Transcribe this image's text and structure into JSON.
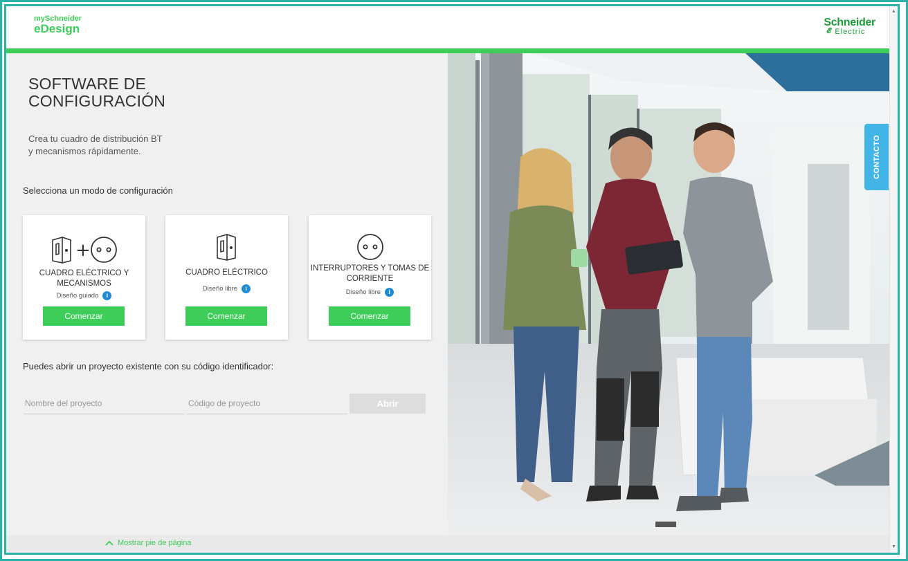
{
  "header": {
    "logo_line1": "mySchneider",
    "logo_line2": "eDesign",
    "brand_line1": "Schneider",
    "brand_line2": "Electric"
  },
  "hero": {
    "title_line1": "SOFTWARE DE",
    "title_line2": "CONFIGURACIÓN",
    "subtitle_line1": "Crea tu cuadro de distribución BT",
    "subtitle_line2": "y mecanismos rápidamente."
  },
  "modes": {
    "label": "Selecciona un modo de configuración",
    "cards": [
      {
        "title_line1": "CUADRO ELÉCTRICO Y",
        "title_line2": "MECANISMOS",
        "sub": "Diseño guiado",
        "button": "Comenzar",
        "icon": "cabinet-plus-socket-icon"
      },
      {
        "title_line1": "CUADRO ELÉCTRICO",
        "title_line2": "",
        "sub": "Diseño libre",
        "button": "Comenzar",
        "icon": "cabinet-icon"
      },
      {
        "title_line1": "INTERRUPTORES Y TOMAS DE",
        "title_line2": "CORRIENTE",
        "sub": "Diseño libre",
        "button": "Comenzar",
        "icon": "socket-icon"
      }
    ]
  },
  "open_project": {
    "label": "Puedes abrir un proyecto existente con su código identificador:",
    "name_placeholder": "Nombre del proyecto",
    "code_placeholder": "Código de proyecto",
    "button": "Abrir"
  },
  "contact_tab": "CONTACTO",
  "footer": {
    "toggle": "Mostrar pie de página"
  },
  "colors": {
    "green": "#3dcd58",
    "teal_frame": "#2ab3a6",
    "blue_tab": "#42b4e6",
    "info_blue": "#1e8cd6"
  }
}
